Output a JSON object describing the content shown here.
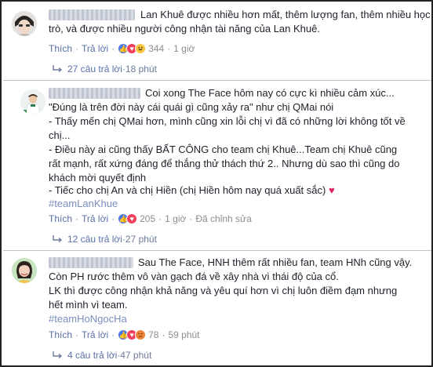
{
  "comments": [
    {
      "lines": [
        "Lan Khuê được nhiều hơn mất, thêm lượng fan, thêm nhiều học",
        "trò, và được nhiều người công nhận tài năng của Lan Khuê."
      ],
      "like_label": "Thích",
      "reply_label": "Trả lời",
      "reaction_count": "344",
      "time": "1 giờ",
      "replies_label": "27 câu trả lời",
      "replies_time": "18 phút",
      "reactions": [
        "like-icon",
        "love-icon",
        "haha-icon"
      ]
    },
    {
      "lines": [
        "Coi xong The Face hôm nay có cực kì nhiều cảm xúc...",
        "\"Đúng là trên đời này cái quái gì cũng xảy ra\" như chị QMai nói",
        "- Thấy mến chị QMai hơn, mình cũng xin lỗi chị vì đã có những lời không tốt về",
        "chị...",
        "- Điều này ai cũng thấy BẤT CÔNG cho team chị Khuê...Team chị Khuê cũng",
        "rất mạnh, rất xứng đáng để thắng thử thách thứ 2.. Nhưng dù sao thì cũng do",
        "khách mời quyết định",
        "- Tiếc cho chị An và chị Hiền (chị Hiền hôm nay quá xuất sắc)"
      ],
      "heart": "♥",
      "hashtag": "#teamLanKhue",
      "like_label": "Thích",
      "reply_label": "Trả lời",
      "reaction_count": "205",
      "time": "1 giờ",
      "edited": "Đã chỉnh sửa",
      "replies_label": "12 câu trả lời",
      "replies_time": "27 phút",
      "reactions": [
        "like-icon",
        "love-icon"
      ]
    },
    {
      "lines": [
        "Sau The Face, HNH thêm rất nhiều fan, team HNh cũng vậy.",
        "Còn PH rước thêm vô vàn gạch đá về xây nhà vì thái độ của cổ.",
        "LK thì được công nhận khả năng và yêu quí hơn vì chị luôn điềm đạm nhưng",
        "hết mình vì team."
      ],
      "hashtag": "#teamHoNgocHa",
      "like_label": "Thích",
      "reply_label": "Trả lời",
      "reaction_count": "78",
      "time": "59 phút",
      "replies_label": "4 câu trả lời",
      "replies_time": "47 phút",
      "reactions": [
        "like-icon",
        "love-icon",
        "angry-icon"
      ]
    }
  ],
  "colors": {
    "link": "#5a70a8",
    "text": "#1d2129",
    "meta": "#8a8d91",
    "hashtag": "#7a8fc0",
    "like": "#4b7bec",
    "love": "#f0405e"
  }
}
